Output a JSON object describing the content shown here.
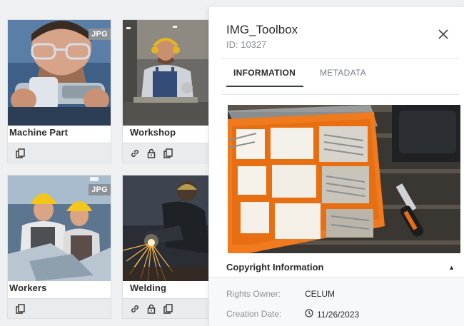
{
  "cards": [
    {
      "title": "Machine Part",
      "badge": "JPG",
      "actions": [
        "copy-icon"
      ]
    },
    {
      "title": "Workshop",
      "badge": "",
      "actions": [
        "link-icon",
        "lock-icon",
        "copy-icon"
      ]
    },
    {
      "title": "Workers",
      "badge": "JPG",
      "actions": [
        "copy-icon"
      ]
    },
    {
      "title": "Welding",
      "badge": "",
      "actions": [
        "link-icon",
        "lock-icon",
        "copy-icon"
      ]
    }
  ],
  "panel": {
    "title": "IMG_Toolbox",
    "id": "ID: 10327",
    "tabs": [
      {
        "label": "INFORMATION",
        "active": true
      },
      {
        "label": "METADATA",
        "active": false
      }
    ],
    "section": {
      "title": "Copyright Information",
      "rows": [
        {
          "label": "Rights Owner:",
          "value": "CELUM"
        },
        {
          "label": "Creation Date:",
          "value": "11/26/2023",
          "icon": "clock-icon"
        }
      ]
    }
  },
  "colors": {
    "accent": "#f07a1e",
    "badge": "#8b9198"
  }
}
